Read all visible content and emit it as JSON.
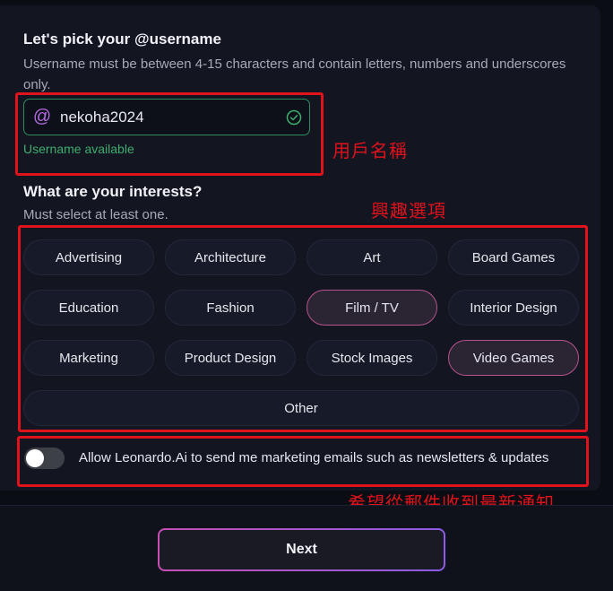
{
  "username_section": {
    "title": "Let's pick your @username",
    "description": "Username must be between 4-15 characters and contain letters, numbers and underscores only.",
    "at_symbol": "@",
    "value": "nekoha2024",
    "status": "Username available"
  },
  "interests_section": {
    "title": "What are your interests?",
    "subtitle": "Must select at least one.",
    "options": [
      {
        "label": "Advertising",
        "selected": false
      },
      {
        "label": "Architecture",
        "selected": false
      },
      {
        "label": "Art",
        "selected": false
      },
      {
        "label": "Board Games",
        "selected": false
      },
      {
        "label": "Education",
        "selected": false
      },
      {
        "label": "Fashion",
        "selected": false
      },
      {
        "label": "Film / TV",
        "selected": true
      },
      {
        "label": "Interior Design",
        "selected": false
      },
      {
        "label": "Marketing",
        "selected": false
      },
      {
        "label": "Product Design",
        "selected": false
      },
      {
        "label": "Stock Images",
        "selected": false
      },
      {
        "label": "Video Games",
        "selected": true
      },
      {
        "label": "Other",
        "selected": false
      }
    ]
  },
  "marketing": {
    "label": "Allow Leonardo.Ai to send me marketing emails such as newsletters & updates",
    "enabled": false
  },
  "footer": {
    "next_label": "Next"
  },
  "annotations": {
    "username": "用戶名稱",
    "interests": "興趣選項",
    "marketing": "希望從郵件收到最新通知"
  },
  "colors": {
    "accent_pink": "#c64fb4",
    "accent_purple": "#8c5ce6",
    "success_green": "#3fae6e",
    "annotation_red": "#e0121b"
  }
}
